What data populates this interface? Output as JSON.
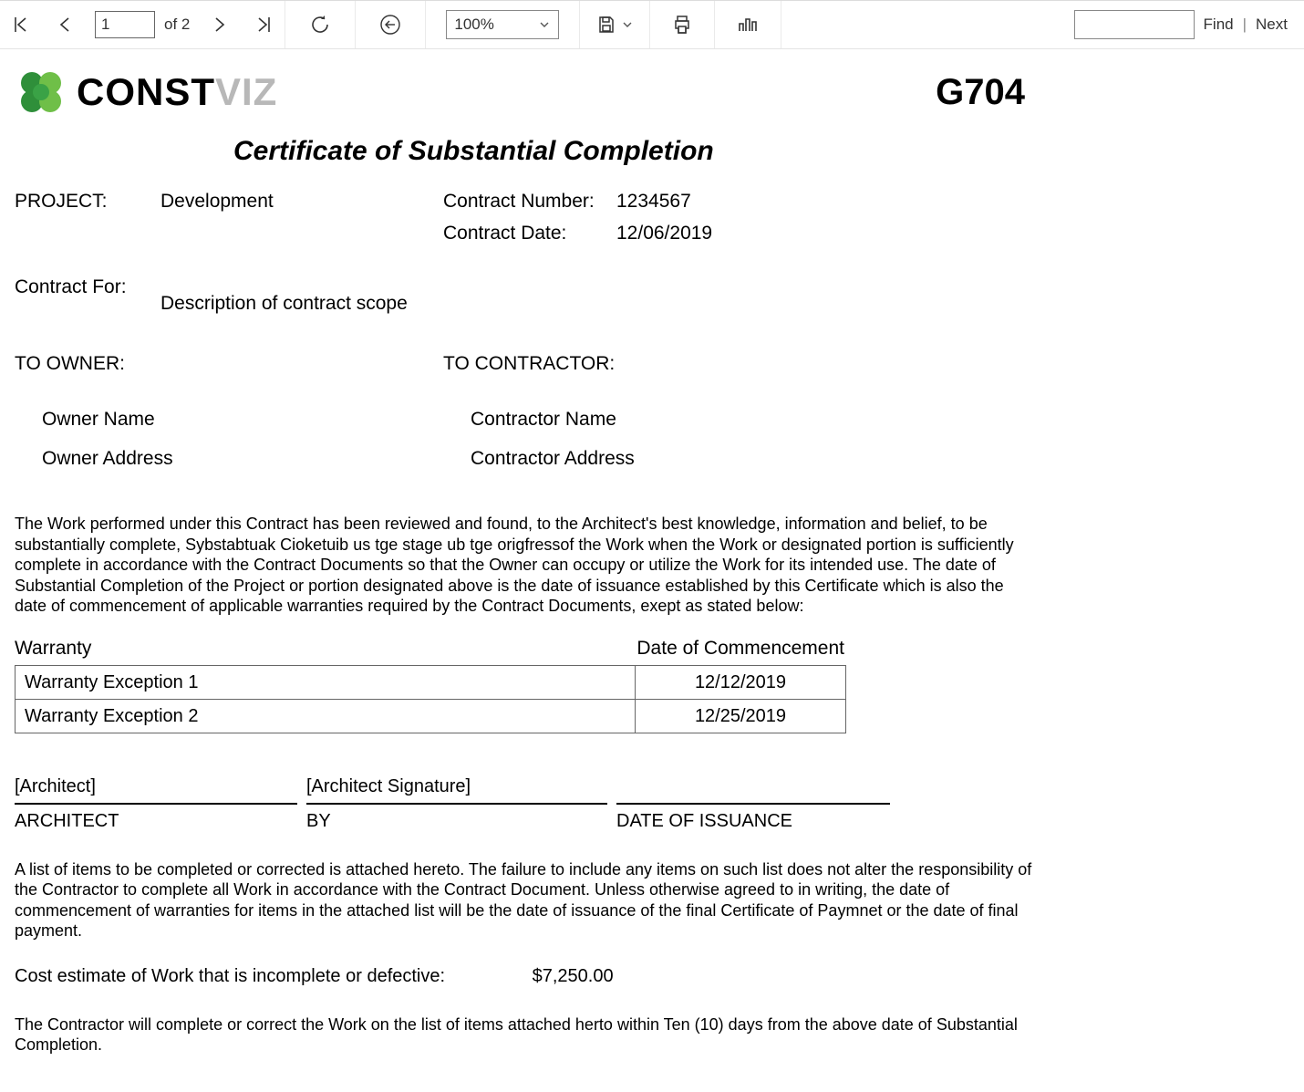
{
  "toolbar": {
    "page_current": "1",
    "page_of_label": "of",
    "page_total": "2",
    "zoom_value": "100%",
    "find_label": "Find",
    "next_label": "Next"
  },
  "brand": {
    "name_strong": "CONST",
    "name_dim": "VIZ"
  },
  "form_id": "G704",
  "title": "Certificate of Substantial Completion",
  "meta": {
    "project_label": "PROJECT:",
    "project_value": "Development",
    "contract_number_label": "Contract Number:",
    "contract_number_value": "1234567",
    "contract_date_label": "Contract Date:",
    "contract_date_value": "12/06/2019",
    "contract_for_label": "Contract For:",
    "contract_for_value": "Description of contract scope"
  },
  "owner": {
    "heading": "TO OWNER:",
    "name": "Owner Name",
    "address": "Owner Address"
  },
  "contractor": {
    "heading": "TO CONTRACTOR:",
    "name": "Contractor Name",
    "address": "Contractor Address"
  },
  "paragraph1": "The Work performed under this Contract has been reviewed and found, to the Architect's best knowledge, information and belief, to be substantially complete,  Sybstabtuak Cioketuib us tge stage ub tge origfressof the Work when the Work or designated portion is sufficiently complete in accordance with the Contract Documents so that the Owner can occupy or utilize the Work for its intended use.  The date of Substantial Completion of the Project or portion designated above is the date of issuance established by this Certificate which is also the date of commencement of applicable warranties required by the Contract Documents, exept as stated below:",
  "warranty": {
    "col1": "Warranty",
    "col2": "Date of Commencement",
    "rows": [
      {
        "name": "Warranty Exception 1",
        "date": "12/12/2019"
      },
      {
        "name": "Warranty Exception 2",
        "date": "12/25/2019"
      }
    ]
  },
  "signatures": {
    "architect_value": "[Architect]",
    "architect_label": "ARCHITECT",
    "by_value": "[Architect Signature]",
    "by_label": "BY",
    "date_value": "",
    "date_label": "DATE OF ISSUANCE"
  },
  "paragraph2": "A list of items to be completed or corrected is attached hereto.  The failure to include any items on such list does not alter the responsibility of the Contractor to complete all Work in accordance with the Contract Document.  Unless otherwise agreed to in writing, the date of commencement of warranties for items in the attached list will be the date of issuance of the final Certificate of Paymnet or the date of final payment.",
  "cost": {
    "label": "Cost estimate of Work that is incomplete or defective:",
    "amount": "$7,250.00"
  },
  "paragraph3": "The Contractor will complete or correct the Work on the list of items attached herto within Ten (10) days from the above date of Substantial Completion."
}
